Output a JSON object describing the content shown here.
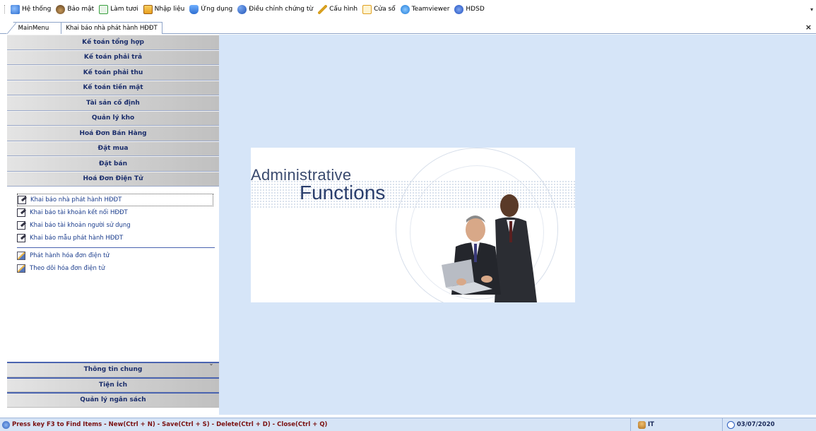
{
  "menubar": {
    "items": [
      {
        "label": "Hệ thống",
        "icon": "system-icon",
        "color": "#2e6fcf"
      },
      {
        "label": "Bảo mật",
        "icon": "security-icon",
        "color": "#5a3c1e"
      },
      {
        "label": "Làm tươi",
        "icon": "refresh-icon",
        "color": "#3aa040"
      },
      {
        "label": "Nhập liệu",
        "icon": "data-entry-icon",
        "color": "#e8a020"
      },
      {
        "label": "Ứng dụng",
        "icon": "application-icon",
        "color": "#2f6fd0"
      },
      {
        "label": "Điều chỉnh chứng từ",
        "icon": "adjust-document-icon",
        "color": "#2356b8"
      },
      {
        "label": "Cấu hình",
        "icon": "config-icon",
        "color": "#d8a020"
      },
      {
        "label": "Cửa sổ",
        "icon": "window-icon",
        "color": "#e0a020"
      },
      {
        "label": "Teamviewer",
        "icon": "teamviewer-icon",
        "color": "#1c7ad8"
      },
      {
        "label": "HDSD",
        "icon": "help-icon",
        "color": "#2050c0"
      }
    ]
  },
  "tabs": {
    "main": "MainMenu",
    "active": "Khai báo nhà phát hành HĐĐT",
    "close_symbol": "×"
  },
  "nav": {
    "categories_top": [
      "Kế toán tổng hợp",
      "Kế toán phải trả",
      "Kế toán phải thu",
      "Kế toán tiền mặt",
      "Tài sản cố định",
      "Quản lý kho",
      "Hoá Đơn Bán Hàng",
      "Đặt mua",
      "Đặt bán",
      "Hoá Đơn Điện Tử"
    ],
    "subitems_group1": [
      "Khai báo nhà phát hành HĐĐT",
      "Khai báo tài khoản kết nối HĐĐT",
      "Khai báo tài khoản người sử dụng",
      "Khai báo mẫu phát hành HĐĐT"
    ],
    "subitems_group2": [
      "Phát hành hóa đơn điện tử",
      "Theo dõi hóa đơn điện tử"
    ],
    "categories_bottom": [
      "Thông tin chung",
      "Tiện Ích",
      "Quản lý ngân sách"
    ]
  },
  "banner": {
    "line1": "Administrative",
    "line2": "Functions"
  },
  "statusbar": {
    "message": "Press key F3 to Find Items - New(Ctrl + N) - Save(Ctrl + S) - Delete(Ctrl + D) - Close(Ctrl + Q)",
    "user": "IT",
    "date": "03/07/2020"
  }
}
